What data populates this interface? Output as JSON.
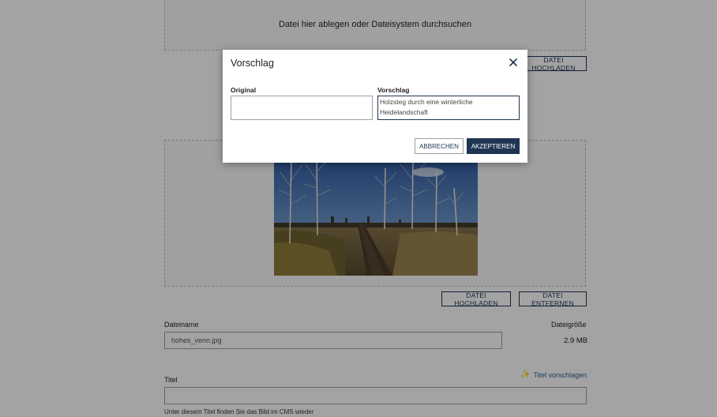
{
  "dropzone_top": {
    "text": "Datei hier ablegen oder Dateisystem durchsuchen",
    "upload_label": "DATEI HOCHLADEN"
  },
  "image_zone": {
    "upload_label": "DATEI HOCHLADEN",
    "remove_label": "DATEI ENTFERNEN"
  },
  "file": {
    "name_label": "Dateiname",
    "name_value": "hohes_venn.jpg",
    "size_label": "Dateigröße",
    "size_value": "2.9 MB"
  },
  "title_field": {
    "label": "Titel",
    "suggest_label": "Titel vorschlagen",
    "value": "",
    "hint": "Unter diesem Titel finden Sie das Bild im CMS wieder"
  },
  "modal": {
    "title": "Vorschlag",
    "original_label": "Original",
    "original_value": "",
    "suggestion_label": "Vorschlag",
    "suggestion_value": "Holzsteg durch eine winterliche Heidelandschaft",
    "cancel_label": "ABBRECHEN",
    "accept_label": "AKZEPTIEREN"
  },
  "icons": {
    "close": "close-icon",
    "sparkle": "sparkle-icon"
  },
  "colors": {
    "primary": "#1f3553",
    "link": "#2f5f8f",
    "sparkle": "#e0b43a",
    "overlay": "rgba(0,0,0,0.36)"
  }
}
